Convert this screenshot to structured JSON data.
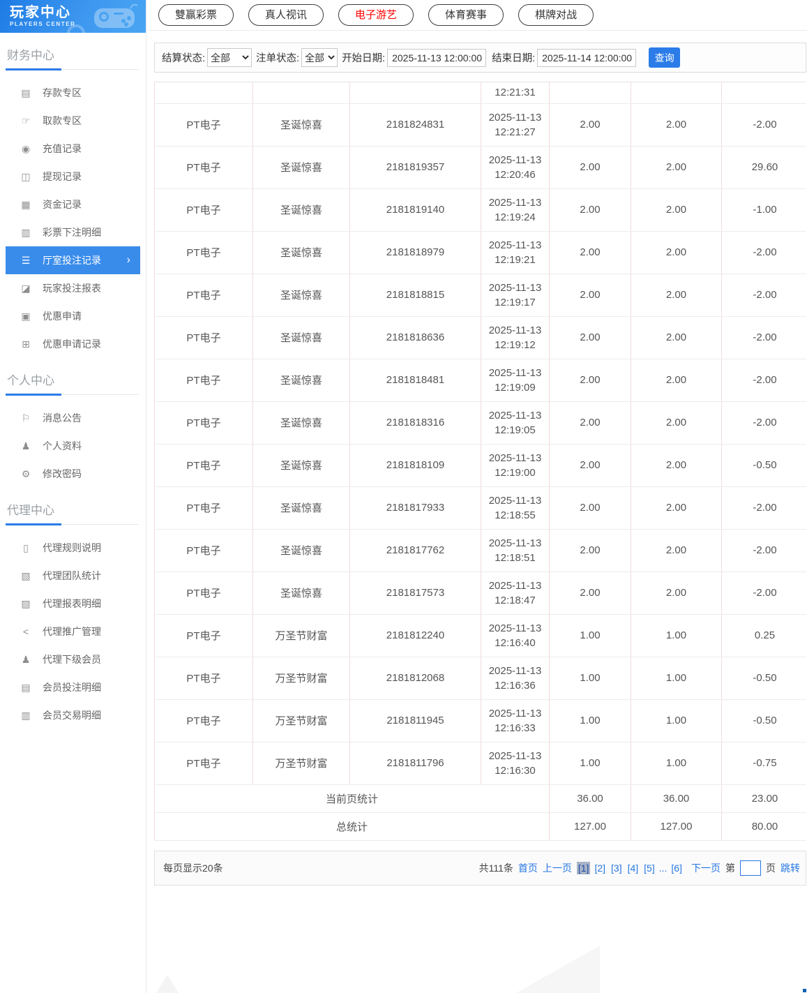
{
  "sidebar": {
    "logo": {
      "title": "玩家中心",
      "subtitle": "PLAYERS CENTER"
    },
    "sections": [
      {
        "title": "财务中心",
        "items": [
          {
            "id": "deposit-zone",
            "label": "存款专区",
            "icon": "bank-card-icon",
            "glyph": "▤",
            "active": false
          },
          {
            "id": "withdraw-zone",
            "label": "取款专区",
            "icon": "hand-coin-icon",
            "glyph": "☞",
            "active": false
          },
          {
            "id": "recharge-records",
            "label": "充值记录",
            "icon": "moneybag-icon",
            "glyph": "◉",
            "active": false
          },
          {
            "id": "cashout-records",
            "label": "提现记录",
            "icon": "wallet-icon",
            "glyph": "◫",
            "active": false
          },
          {
            "id": "funds-records",
            "label": "资金记录",
            "icon": "coins-icon",
            "glyph": "▦",
            "active": false
          },
          {
            "id": "lottery-bet-detail",
            "label": "彩票下注明细",
            "icon": "lottery-list-icon",
            "glyph": "▥",
            "active": false
          },
          {
            "id": "hall-bet-records",
            "label": "厅室投注记录",
            "icon": "bet-records-icon",
            "glyph": "☰",
            "active": true
          },
          {
            "id": "player-bet-report",
            "label": "玩家投注报表",
            "icon": "report-chart-icon",
            "glyph": "◪",
            "active": false
          },
          {
            "id": "promo-apply",
            "label": "优惠申请",
            "icon": "ticket-icon",
            "glyph": "▣",
            "active": false
          },
          {
            "id": "promo-apply-records",
            "label": "优惠申请记录",
            "icon": "ticket-list-icon",
            "glyph": "⊞",
            "active": false
          }
        ]
      },
      {
        "title": "个人中心",
        "items": [
          {
            "id": "messages",
            "label": "消息公告",
            "icon": "bell-icon",
            "glyph": "⚐",
            "active": false
          },
          {
            "id": "profile",
            "label": "个人资料",
            "icon": "person-icon",
            "glyph": "♟",
            "active": false
          },
          {
            "id": "change-password",
            "label": "修改密码",
            "icon": "gear-icon",
            "glyph": "⚙",
            "active": false
          }
        ]
      },
      {
        "title": "代理中心",
        "items": [
          {
            "id": "agent-rules",
            "label": "代理规则说明",
            "icon": "document-icon",
            "glyph": "▯",
            "active": false
          },
          {
            "id": "agent-team-stats",
            "label": "代理团队统计",
            "icon": "team-stats-icon",
            "glyph": "▧",
            "active": false
          },
          {
            "id": "agent-report-detail",
            "label": "代理报表明细",
            "icon": "report-detail-icon",
            "glyph": "▨",
            "active": false
          },
          {
            "id": "agent-promotion",
            "label": "代理推广管理",
            "icon": "share-icon",
            "glyph": "<",
            "active": false
          },
          {
            "id": "agent-sub-members",
            "label": "代理下级会员",
            "icon": "members-icon",
            "glyph": "♟",
            "active": false
          },
          {
            "id": "member-bet-detail",
            "label": "会员投注明细",
            "icon": "member-bet-icon",
            "glyph": "▤",
            "active": false
          },
          {
            "id": "member-trade-detail",
            "label": "会员交易明细",
            "icon": "member-trade-icon",
            "glyph": "▥",
            "active": false
          }
        ]
      }
    ]
  },
  "tabs": [
    {
      "id": "lottery",
      "label": "雙赢彩票",
      "active": false
    },
    {
      "id": "live",
      "label": "真人视讯",
      "active": false
    },
    {
      "id": "egames",
      "label": "电子游艺",
      "active": true
    },
    {
      "id": "sports",
      "label": "体育赛事",
      "active": false
    },
    {
      "id": "boardgame",
      "label": "棋牌对战",
      "active": false
    }
  ],
  "filters": {
    "settle_status_label": "结算状态:",
    "settle_status_value": "全部",
    "order_status_label": "注单状态:",
    "order_status_value": "全部",
    "start_date_label": "开始日期:",
    "start_date_value": "2025-11-13 12:00:00",
    "end_date_label": "结束日期:",
    "end_date_value": "2025-11-14 12:00:00",
    "search_button": "查询"
  },
  "table": {
    "partial_row_time": "12:21:31",
    "rows": [
      {
        "hall": "PT电子",
        "game": "圣诞惊喜",
        "order_no": "2181824831",
        "date": "2025-11-13",
        "time": "12:21:27",
        "bet": "2.00",
        "valid": "2.00",
        "winloss": "-2.00"
      },
      {
        "hall": "PT电子",
        "game": "圣诞惊喜",
        "order_no": "2181819357",
        "date": "2025-11-13",
        "time": "12:20:46",
        "bet": "2.00",
        "valid": "2.00",
        "winloss": "29.60"
      },
      {
        "hall": "PT电子",
        "game": "圣诞惊喜",
        "order_no": "2181819140",
        "date": "2025-11-13",
        "time": "12:19:24",
        "bet": "2.00",
        "valid": "2.00",
        "winloss": "-1.00"
      },
      {
        "hall": "PT电子",
        "game": "圣诞惊喜",
        "order_no": "2181818979",
        "date": "2025-11-13",
        "time": "12:19:21",
        "bet": "2.00",
        "valid": "2.00",
        "winloss": "-2.00"
      },
      {
        "hall": "PT电子",
        "game": "圣诞惊喜",
        "order_no": "2181818815",
        "date": "2025-11-13",
        "time": "12:19:17",
        "bet": "2.00",
        "valid": "2.00",
        "winloss": "-2.00"
      },
      {
        "hall": "PT电子",
        "game": "圣诞惊喜",
        "order_no": "2181818636",
        "date": "2025-11-13",
        "time": "12:19:12",
        "bet": "2.00",
        "valid": "2.00",
        "winloss": "-2.00"
      },
      {
        "hall": "PT电子",
        "game": "圣诞惊喜",
        "order_no": "2181818481",
        "date": "2025-11-13",
        "time": "12:19:09",
        "bet": "2.00",
        "valid": "2.00",
        "winloss": "-2.00"
      },
      {
        "hall": "PT电子",
        "game": "圣诞惊喜",
        "order_no": "2181818316",
        "date": "2025-11-13",
        "time": "12:19:05",
        "bet": "2.00",
        "valid": "2.00",
        "winloss": "-2.00"
      },
      {
        "hall": "PT电子",
        "game": "圣诞惊喜",
        "order_no": "2181818109",
        "date": "2025-11-13",
        "time": "12:19:00",
        "bet": "2.00",
        "valid": "2.00",
        "winloss": "-0.50"
      },
      {
        "hall": "PT电子",
        "game": "圣诞惊喜",
        "order_no": "2181817933",
        "date": "2025-11-13",
        "time": "12:18:55",
        "bet": "2.00",
        "valid": "2.00",
        "winloss": "-2.00"
      },
      {
        "hall": "PT电子",
        "game": "圣诞惊喜",
        "order_no": "2181817762",
        "date": "2025-11-13",
        "time": "12:18:51",
        "bet": "2.00",
        "valid": "2.00",
        "winloss": "-2.00"
      },
      {
        "hall": "PT电子",
        "game": "圣诞惊喜",
        "order_no": "2181817573",
        "date": "2025-11-13",
        "time": "12:18:47",
        "bet": "2.00",
        "valid": "2.00",
        "winloss": "-2.00"
      },
      {
        "hall": "PT电子",
        "game": "万圣节财富",
        "order_no": "2181812240",
        "date": "2025-11-13",
        "time": "12:16:40",
        "bet": "1.00",
        "valid": "1.00",
        "winloss": "0.25"
      },
      {
        "hall": "PT电子",
        "game": "万圣节财富",
        "order_no": "2181812068",
        "date": "2025-11-13",
        "time": "12:16:36",
        "bet": "1.00",
        "valid": "1.00",
        "winloss": "-0.50"
      },
      {
        "hall": "PT电子",
        "game": "万圣节财富",
        "order_no": "2181811945",
        "date": "2025-11-13",
        "time": "12:16:33",
        "bet": "1.00",
        "valid": "1.00",
        "winloss": "-0.50"
      },
      {
        "hall": "PT电子",
        "game": "万圣节财富",
        "order_no": "2181811796",
        "date": "2025-11-13",
        "time": "12:16:30",
        "bet": "1.00",
        "valid": "1.00",
        "winloss": "-0.75"
      }
    ],
    "summary_page": {
      "label": "当前页统计",
      "bet": "36.00",
      "valid": "36.00",
      "winloss": "23.00"
    },
    "summary_total": {
      "label": "总统计",
      "bet": "127.00",
      "valid": "127.00",
      "winloss": "80.00"
    }
  },
  "pagination": {
    "page_size_text": "每页显示20条",
    "total_text": "共111条",
    "first_label": "首页",
    "prev_label": "上一页",
    "pages": [
      {
        "label": "[1]",
        "current": true,
        "interactable": true
      },
      {
        "label": "[2]",
        "current": false,
        "interactable": true
      },
      {
        "label": "[3]",
        "current": false,
        "interactable": true
      },
      {
        "label": "[4]",
        "current": false,
        "interactable": true
      },
      {
        "label": "[5]",
        "current": false,
        "interactable": true
      },
      {
        "label": "...",
        "current": false,
        "interactable": false
      },
      {
        "label": "[6]",
        "current": false,
        "interactable": true
      }
    ],
    "next_label": "下一页",
    "jump_prefix": "第",
    "jump_suffix": "页",
    "jump_button": "跳转"
  },
  "colors": {
    "accent_blue": "#2b7ce9",
    "sidebar_active_bg": "#3a8ceb",
    "active_tab_red": "#ff0000",
    "table_vertical_border": "#f3dada",
    "table_horizontal_border": "#ececec",
    "header_gradient_start": "#1d7be5",
    "header_gradient_end": "#4aa6f3"
  }
}
